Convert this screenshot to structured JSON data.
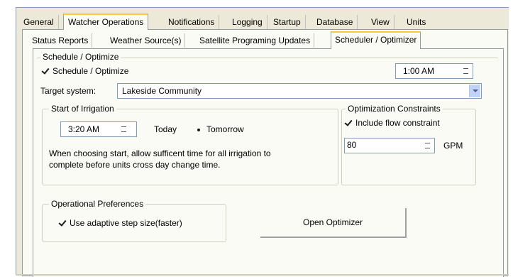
{
  "outer_tabs": [
    "General",
    "Watcher Operations",
    "Notifications",
    "Logging",
    "Startup",
    "Database",
    "View",
    "Units"
  ],
  "inner_tabs": [
    "Status Reports",
    "Weather Source(s)",
    "Satellite Programing Updates",
    "Scheduler / Optimizer"
  ],
  "schedule": {
    "group_label": "Schedule / Optimize",
    "checkbox_label": "Schedule / Optimize",
    "checked": true,
    "time": "1:00 AM"
  },
  "target": {
    "label": "Target system:",
    "value": "Lakeside Community"
  },
  "start_irrigation": {
    "group_label": "Start of Irrigation",
    "time": "3:20 AM",
    "option_today": "Today",
    "option_tomorrow": "Tomorrow",
    "selected": "Tomorrow",
    "note_line1": "When choosing start, allow sufficent time for  all irrigation to",
    "note_line2": "complete before units cross day change time."
  },
  "constraints": {
    "group_label": "Optimization Constraints",
    "checkbox_label": "Include flow constraint",
    "checked": true,
    "flow_value": "80",
    "unit": "GPM"
  },
  "preferences": {
    "group_label": "Operational Preferences",
    "checkbox_label": "Use adaptive step size(faster)",
    "checked": true
  },
  "open_optimizer_label": "Open Optimizer"
}
